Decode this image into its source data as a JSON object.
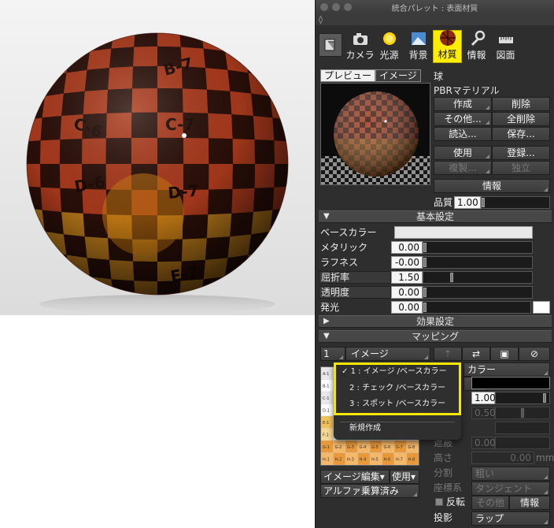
{
  "window": {
    "title": "統合パレット : 表面材質"
  },
  "tabs": [
    {
      "label": "カメラ",
      "icon": "camera-icon"
    },
    {
      "label": "光源",
      "icon": "sun-icon"
    },
    {
      "label": "背景",
      "icon": "background-icon"
    },
    {
      "label": "材質",
      "icon": "material-sphere-icon",
      "active": true
    },
    {
      "label": "情報",
      "icon": "wrench-icon"
    },
    {
      "label": "図面",
      "icon": "ruler-icon"
    }
  ],
  "preview": {
    "tabs": [
      "プレビュー",
      "イメージ"
    ],
    "object_name": "球",
    "material_name": "PBRマテリアル"
  },
  "buttons": {
    "create": "作成",
    "delete": "削除",
    "other": "その他...",
    "delete_all": "全削除",
    "load": "読込...",
    "save": "保存...",
    "use": "使用",
    "register": "登録...",
    "duplicate": "複製...",
    "independent": "独立",
    "info": "情報"
  },
  "quality": {
    "label": "品質",
    "value": "1.00"
  },
  "sections": {
    "basic": "基本設定",
    "effects": "効果設定",
    "mapping": "マッピング"
  },
  "basic": {
    "base_color_label": "ベースカラー",
    "base_color": "#e8e8e8",
    "metallic_label": "メタリック",
    "metallic_value": "0.00",
    "roughness_label": "ラフネス",
    "roughness_value": "-0.00",
    "ior_label": "屈折率",
    "ior_value": "1.50",
    "transparency_label": "透明度",
    "transparency_value": "0.00",
    "emission_label": "発光",
    "emission_value": "0.00",
    "emission_color": "#ffffff"
  },
  "mapping": {
    "layer_index": "1",
    "layer_type": "イメージ",
    "color_label": "カラー",
    "value_1": "1.00",
    "value_2": "0.50",
    "value_3": "0.00",
    "height_label": "高さ",
    "height_value": "0.00",
    "height_unit": "mm",
    "division_label": "分割",
    "division_value": "粗い",
    "coord_label": "座標系",
    "coord_value": "タンジェント",
    "invert_label": "反転",
    "other_button": "その他",
    "info_button": "情報",
    "projection_label": "投影",
    "projection_value": "ラップ",
    "occlusion_label": "遮蔽",
    "image_edit": "イメージ編集",
    "use_menu": "使用",
    "alpha_mode": "アルファ乗算済み"
  },
  "dropdown": {
    "items": [
      {
        "label": "1 : イメージ /ベースカラー",
        "checked": true
      },
      {
        "label": "2 : チェック /ベースカラー",
        "checked": false
      },
      {
        "label": "3 : スポット /ベースカラー",
        "checked": false
      }
    ],
    "new_item": "新規作成"
  },
  "thumb_rows": [
    {
      "row": "A",
      "labels": [
        "A-1"
      ]
    },
    {
      "row": "B",
      "labels": [
        "B-1"
      ]
    },
    {
      "row": "C",
      "labels": [
        "C-1"
      ]
    },
    {
      "row": "D",
      "labels": [
        "D-1"
      ]
    },
    {
      "row": "E",
      "labels": [
        "E-1"
      ]
    },
    {
      "row": "F",
      "labels": [
        "F-1"
      ]
    },
    {
      "row": "G",
      "labels": [
        "G-1",
        "G-2",
        "G-3",
        "G-4",
        "G-5",
        "G-6",
        "G-7",
        "G-8"
      ]
    },
    {
      "row": "H",
      "labels": [
        "H-1",
        "H-2",
        "H-3",
        "H-4",
        "H-5",
        "H-6",
        "H-7",
        "H-8"
      ]
    }
  ],
  "sphere_labels": [
    "B-7",
    "C-6",
    "C-7",
    "D-6",
    "D-7",
    "E-7"
  ],
  "colors": {
    "accent": "#ffee00",
    "panel": "#2e2e2e",
    "checker_red": "#a8391c",
    "checker_dark": "#2a0f08"
  }
}
